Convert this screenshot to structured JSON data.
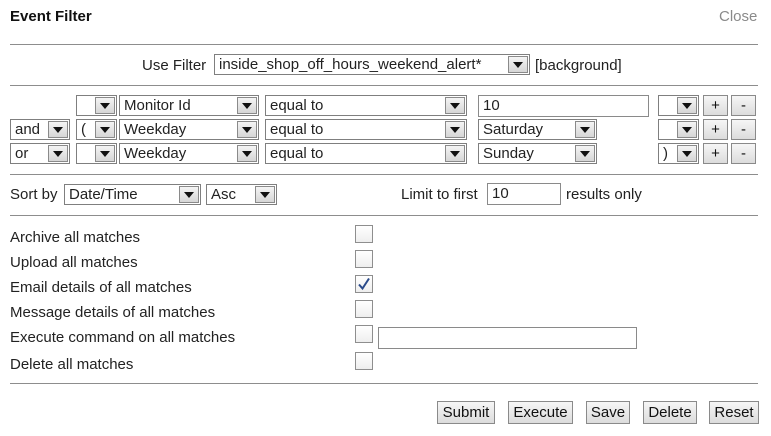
{
  "dialog": {
    "title": "Event Filter",
    "close_label": "Close"
  },
  "use_filter": {
    "label": "Use Filter",
    "selected": "inside_shop_off_hours_weekend_alert*",
    "background_label": "[background]"
  },
  "conditions": [
    {
      "conjunction": "",
      "open_bracket": "",
      "field": "Monitor Id",
      "operator": "equal to",
      "value": "10",
      "value_type": "text",
      "close_bracket": "",
      "add_label": "+",
      "remove_label": "-"
    },
    {
      "conjunction": "and",
      "open_bracket": "(",
      "field": "Weekday",
      "operator": "equal to",
      "value": "Saturday",
      "value_type": "select",
      "close_bracket": "",
      "add_label": "+",
      "remove_label": "-"
    },
    {
      "conjunction": "or",
      "open_bracket": "",
      "field": "Weekday",
      "operator": "equal to",
      "value": "Sunday",
      "value_type": "select",
      "close_bracket": ")",
      "add_label": "+",
      "remove_label": "-"
    }
  ],
  "sort": {
    "label": "Sort by",
    "field": "Date/Time",
    "direction": "Asc",
    "limit_label": "Limit to first",
    "limit_value": "10",
    "limit_suffix": "results only"
  },
  "actions": [
    {
      "label": "Archive all matches",
      "checked": false
    },
    {
      "label": "Upload all matches",
      "checked": false
    },
    {
      "label": "Email details of all matches",
      "checked": true
    },
    {
      "label": "Message details of all matches",
      "checked": false
    },
    {
      "label": "Execute command on all matches",
      "checked": false,
      "command_value": ""
    },
    {
      "label": "Delete all matches",
      "checked": false
    }
  ],
  "buttons": {
    "submit": "Submit",
    "execute": "Execute",
    "save": "Save",
    "delete": "Delete",
    "reset": "Reset"
  },
  "icons": {
    "dropdown": "chevron-down-icon",
    "checkmark": "checkmark-icon"
  },
  "colors": {
    "divider": "#8d8d8d",
    "close_link": "#8a8a8a",
    "checkmark": "#2a4a8a"
  }
}
